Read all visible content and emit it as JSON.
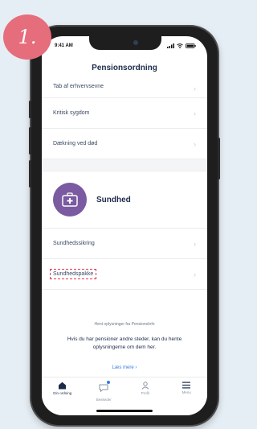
{
  "step": {
    "label": "1."
  },
  "status_bar": {
    "time": "9:41 AM"
  },
  "header": {
    "title": "Pensionsordning"
  },
  "list": {
    "items": [
      {
        "label": "Tab af erhvervsevne"
      },
      {
        "label": "Kritisk sygdom"
      },
      {
        "label": "Dækning ved død"
      }
    ]
  },
  "section": {
    "title": "Sundhed",
    "items": [
      {
        "label": "Sundhedssikring"
      },
      {
        "label": "Sundhedspakke"
      }
    ]
  },
  "info": {
    "small": "Hent oplysninger fra PensionsInfo",
    "main": "Hvis du har pensioner andre steder, kan du hente oplysningerne om dem her.",
    "link": "Læs mere ›"
  },
  "tabbar": {
    "items": [
      {
        "label": "Din ordning",
        "icon": "house-icon",
        "active": true
      },
      {
        "label": "Beskeder",
        "icon": "message-icon",
        "active": false
      },
      {
        "label": "Profil",
        "icon": "person-icon",
        "active": false
      },
      {
        "label": "Menu",
        "icon": "menu-icon",
        "active": false
      }
    ]
  },
  "colors": {
    "accent": "#7a5aa0",
    "highlight": "#e2384d",
    "badge": "#e66d7b",
    "link": "#3a7bd5"
  }
}
